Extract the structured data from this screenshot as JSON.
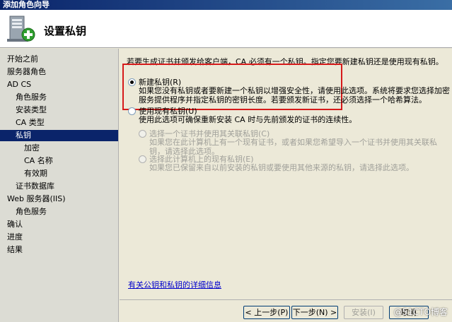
{
  "window": {
    "title": "添加角色向导"
  },
  "header": {
    "title": "设置私钥",
    "icon": "server-key-icon"
  },
  "sidebar": {
    "items": [
      {
        "label": "开始之前"
      },
      {
        "label": "服务器角色"
      },
      {
        "label": "AD CS"
      },
      {
        "label": "角色服务"
      },
      {
        "label": "安装类型"
      },
      {
        "label": "CA 类型"
      },
      {
        "label": "私钥"
      },
      {
        "label": "加密"
      },
      {
        "label": "CA 名称"
      },
      {
        "label": "有效期"
      },
      {
        "label": "证书数据库"
      },
      {
        "label": "Web 服务器(IIS)"
      },
      {
        "label": "角色服务"
      },
      {
        "label": "确认"
      },
      {
        "label": "进度"
      },
      {
        "label": "结果"
      }
    ],
    "active_index": 6
  },
  "main": {
    "intro": "若要生成证书并颁发给客户端，CA 必须有一个私钥。指定您要新建私钥还是使用现有私钥。",
    "option_new": {
      "label": "新建私钥(R)",
      "desc": "如果您没有私钥或者要新建一个私钥以增强安全性，请使用此选项。系统将要求您选择加密服务提供程序并指定私钥的密钥长度。若要颁发新证书，还必须选择一个哈希算法。"
    },
    "option_existing": {
      "label": "使用现有私钥(U)",
      "desc": "使用此选项可确保重新安装 CA 时与先前颁发的证书的连续性。"
    },
    "sub_cert": {
      "label": "选择一个证书并使用其关联私钥(C)",
      "desc": "如果您在此计算机上有一个现有证书，或者如果您希望导入一个证书并使用其关联私钥，请选择此选项。"
    },
    "sub_key": {
      "label": "选择此计算机上的现有私钥(E)",
      "desc": "如果您已保留来自以前安装的私钥或要使用其他来源的私钥，请选择此选项。"
    },
    "link": "有关公钥和私钥的详细信息"
  },
  "footer": {
    "back": "< 上一步(P)",
    "next": "下一步(N) >",
    "install": "安装(I)",
    "cancel": "取消"
  },
  "watermark": "@51CTO博客",
  "colors": {
    "highlight": "#d61a1a",
    "nav_active": "#0a246a",
    "link": "#0000cc"
  }
}
